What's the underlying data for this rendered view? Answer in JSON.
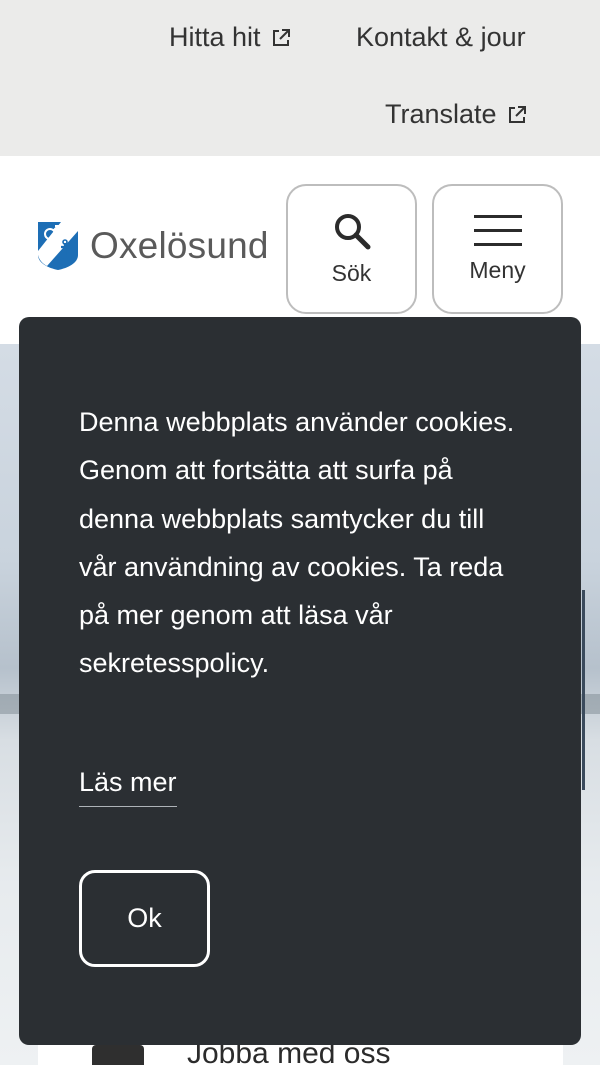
{
  "topbar": {
    "links": [
      {
        "label": "Hitta hit",
        "icon": "external-link-icon"
      },
      {
        "label": "Kontakt & jour"
      },
      {
        "label": "Translate",
        "icon": "external-link-icon"
      }
    ]
  },
  "header": {
    "logo_text": "Oxelösund",
    "logo_icon": "municipal-coat-of-arms-icon",
    "search_label": "Sök",
    "search_icon": "search-icon",
    "menu_label": "Meny",
    "menu_icon": "hamburger-icon"
  },
  "content": {
    "jobba_label": "Jobba med oss",
    "jobba_icon": "briefcase-icon"
  },
  "cookie_banner": {
    "message": "Denna webbplats använder cookies. Genom att fortsätta att surfa på denna webbplats samtycker du till vår användning av cookies. Ta reda på mer genom att läsa vår sekretesspolicy.",
    "link_label": "Läs mer",
    "ok_label": "Ok"
  },
  "colors": {
    "topbar_bg": "#ebebea",
    "banner_bg": "#2b2f33",
    "logo_blue": "#1d6eb5"
  }
}
